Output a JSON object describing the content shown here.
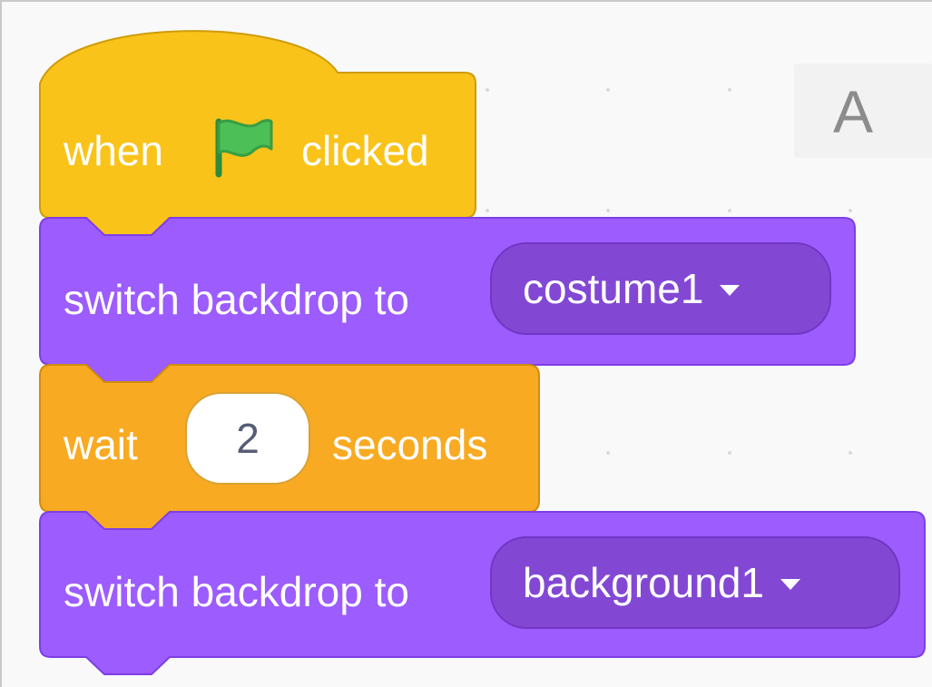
{
  "workspace": {
    "corner_letter": "A"
  },
  "colors": {
    "events": "#ffbf00",
    "looks": "#9966ff",
    "control": "#ffab19",
    "flag": "#4cbf56"
  },
  "script": {
    "hat": {
      "text_before": "when",
      "icon": "green-flag-icon",
      "text_after": "clicked"
    },
    "switch1": {
      "label": "switch backdrop to",
      "value": "costume1"
    },
    "wait": {
      "label_before": "wait",
      "value": "2",
      "label_after": "seconds"
    },
    "switch2": {
      "label": "switch backdrop to",
      "value": "background1"
    }
  }
}
